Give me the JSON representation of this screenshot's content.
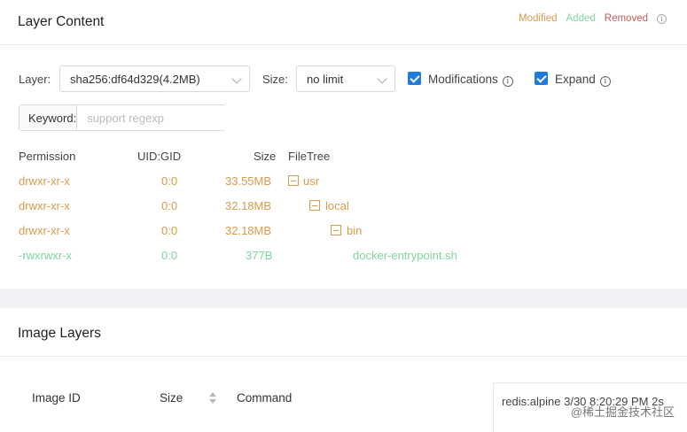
{
  "layer_content": {
    "title": "Layer Content",
    "legend": {
      "modified": "Modified",
      "added": "Added",
      "removed": "Removed",
      "colors": {
        "modified": "#d99a4a",
        "added": "#8fdcaa",
        "removed": "#c25a5a"
      }
    },
    "controls": {
      "layer_label": "Layer:",
      "layer_value": "sha256:df64d329(4.2MB)",
      "size_label": "Size:",
      "size_value": "no limit",
      "modifications_label": "Modifications",
      "expand_label": "Expand",
      "keyword_label": "Keyword:",
      "keyword_placeholder": "support regexp"
    },
    "columns": [
      "Permission",
      "UID:GID",
      "Size",
      "FileTree"
    ],
    "rows": [
      {
        "permission": "drwxr-xr-x",
        "uidgid": "0:0",
        "size": "33.55MB",
        "name": "usr",
        "status": "modified",
        "depth": 0,
        "folder": true
      },
      {
        "permission": "drwxr-xr-x",
        "uidgid": "0:0",
        "size": "32.18MB",
        "name": "local",
        "status": "modified",
        "depth": 1,
        "folder": true
      },
      {
        "permission": "drwxr-xr-x",
        "uidgid": "0:0",
        "size": "32.18MB",
        "name": "bin",
        "status": "modified",
        "depth": 2,
        "folder": true
      },
      {
        "permission": "-rwxrwxr-x",
        "uidgid": "0:0",
        "size": "377B",
        "name": "docker-entrypoint.sh",
        "status": "added",
        "depth": 3,
        "folder": false
      }
    ]
  },
  "image_layers": {
    "title": "Image Layers",
    "columns": [
      "Image ID",
      "Size",
      "Command"
    ],
    "side_text": "redis:alpine 3/30 8:20:29 PM 2s"
  },
  "watermark": "@稀土掘金技术社区"
}
